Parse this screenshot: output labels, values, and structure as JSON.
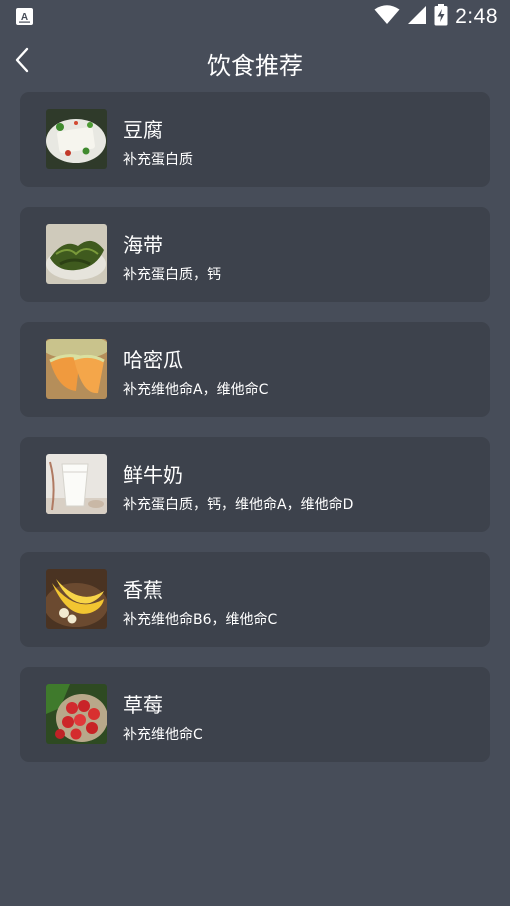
{
  "status_bar": {
    "time": "2:48",
    "icons": [
      "notification-a-icon",
      "wifi-icon",
      "signal-icon",
      "battery-charging-icon"
    ]
  },
  "header": {
    "title": "饮食推荐",
    "back_icon": "back-arrow-icon"
  },
  "foods": [
    {
      "name": "豆腐",
      "desc": "补充蛋白质",
      "image": "tofu-photo"
    },
    {
      "name": "海带",
      "desc": "补充蛋白质，钙",
      "image": "kelp-photo"
    },
    {
      "name": "哈密瓜",
      "desc": "补充维他命A，维他命C",
      "image": "cantaloupe-photo"
    },
    {
      "name": "鲜牛奶",
      "desc": "补充蛋白质，钙，维他命A，维他命D",
      "image": "milk-photo"
    },
    {
      "name": "香蕉",
      "desc": "补充维他命B6，维他命C",
      "image": "banana-photo"
    },
    {
      "name": "草莓",
      "desc": "补充维他命C",
      "image": "strawberry-photo"
    }
  ]
}
